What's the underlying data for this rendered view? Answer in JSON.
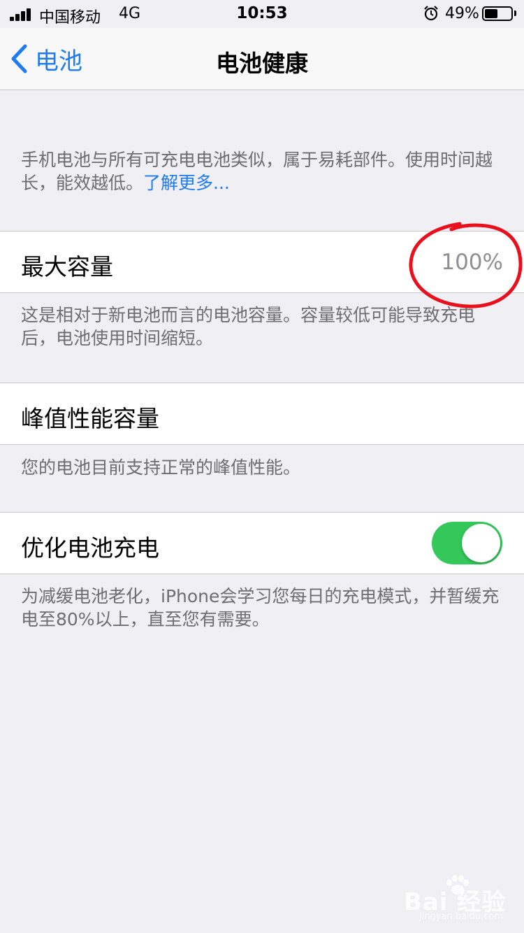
{
  "status_bar": {
    "carrier": "中国移动",
    "network": "4G",
    "time": "10:53",
    "battery_percent": "49%",
    "battery_level": 0.49
  },
  "nav": {
    "back_label": "电池",
    "title": "电池健康"
  },
  "intro": {
    "text": "手机电池与所有可充电电池类似，属于易耗部件。使用时间越长，能效越低。",
    "link": "了解更多..."
  },
  "max_capacity": {
    "label": "最大容量",
    "value": "100%",
    "note": "这是相对于新电池而言的电池容量。容量较低可能导致充电后，电池使用时间缩短。"
  },
  "peak_performance": {
    "label": "峰值性能容量",
    "note": "您的电池目前支持正常的峰值性能。"
  },
  "optimized_charging": {
    "label": "优化电池充电",
    "enabled": true,
    "note": "为减缓电池老化，iPhone会学习您每日的充电模式，并暂缓充电至80%以上，直至您有需要。"
  },
  "watermark": {
    "text": "Bai 经验",
    "sub": "jingyan.baidu.com"
  },
  "colors": {
    "accent": "#1f7cf0",
    "toggle_on": "#34c759",
    "annotation": "#e8101c",
    "background": "#efeff4"
  },
  "icons": [
    "signal-icon",
    "alarm-icon",
    "battery-icon",
    "chevron-left-icon"
  ]
}
